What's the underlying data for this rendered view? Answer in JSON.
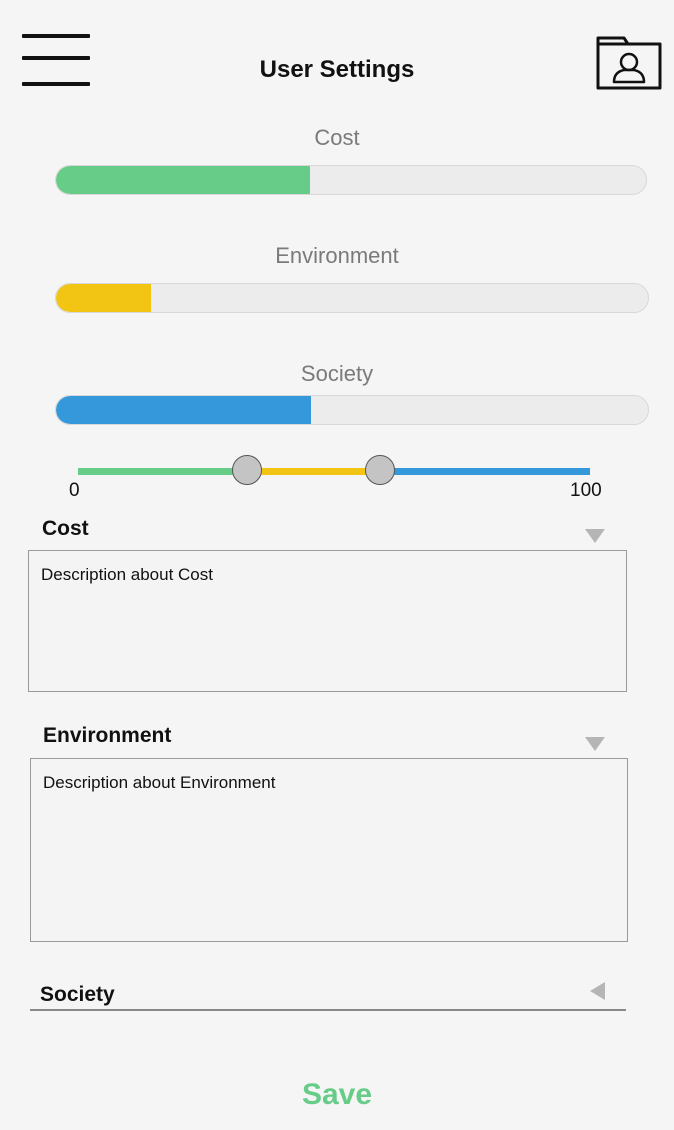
{
  "header": {
    "title": "User Settings",
    "menu_icon": "hamburger-menu-icon",
    "profile_icon": "user-folder-icon"
  },
  "bars": [
    {
      "label": "Cost",
      "percent": 43,
      "color": "#66cc88"
    },
    {
      "label": "Environment",
      "percent": 16,
      "color": "#f2c515"
    },
    {
      "label": "Society",
      "percent": 43,
      "color": "#3498db"
    }
  ],
  "slider": {
    "min_label": "0",
    "max_label": "100",
    "min": 0,
    "max": 100,
    "handle1": 33,
    "handle2": 59,
    "colors": [
      "#66cc88",
      "#f2c515",
      "#3498db"
    ]
  },
  "sections": [
    {
      "title": "Cost",
      "description": "Description about Cost",
      "expanded": true
    },
    {
      "title": "Environment",
      "description": "Description about Environment",
      "expanded": true
    },
    {
      "title": "Society",
      "expanded": false
    }
  ],
  "save_label": "Save"
}
